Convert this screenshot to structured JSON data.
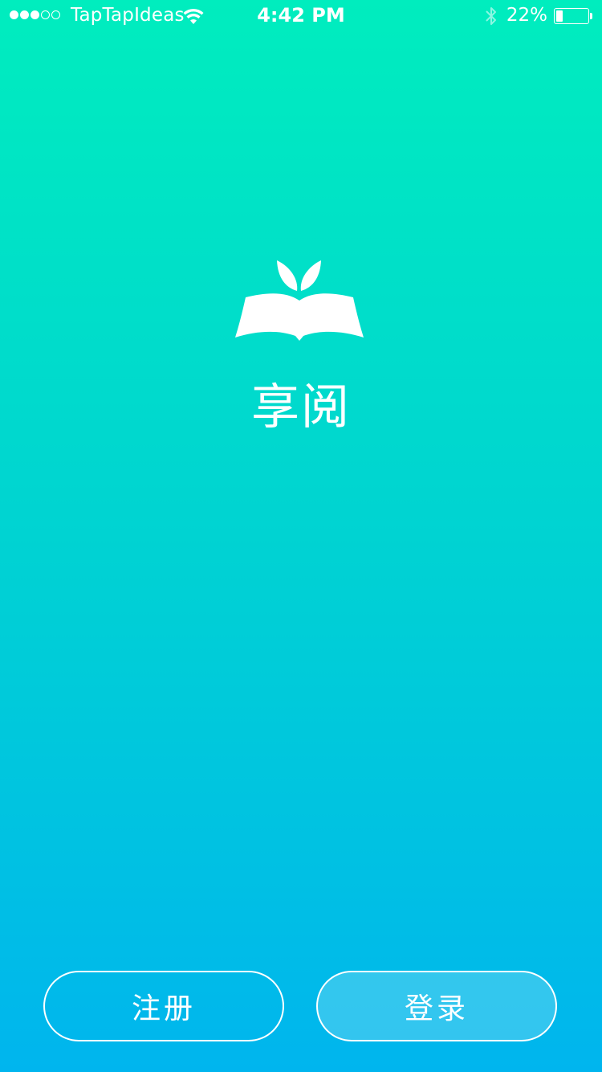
{
  "status_bar": {
    "carrier": "TapTapIdeas",
    "time": "4:42 PM",
    "battery_percent": "22%",
    "battery_level": 0.22,
    "signal_bars_filled": 3,
    "signal_bars_total": 5,
    "icons": [
      "signal-dots",
      "wifi-icon",
      "bluetooth-icon",
      "battery-icon"
    ]
  },
  "app": {
    "name": "享阅",
    "logo_icon": "book-sprout-icon"
  },
  "buttons": {
    "register_label": "注册",
    "login_label": "登录"
  },
  "colors": {
    "gradient_top": "#00EDBE",
    "gradient_mid": "#00D3D2",
    "gradient_bottom": "#00B5EE",
    "foreground": "#FFFFFF"
  }
}
